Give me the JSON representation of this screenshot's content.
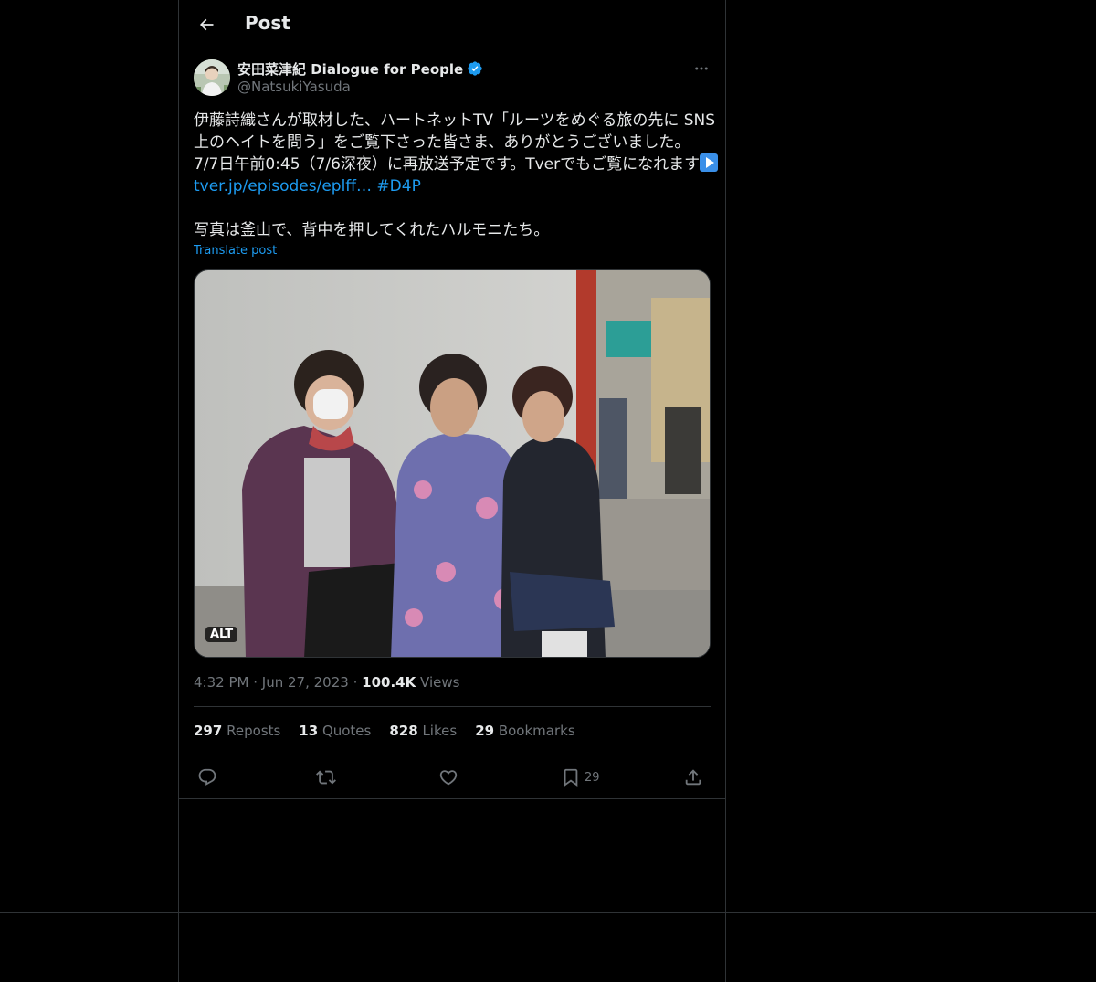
{
  "header": {
    "title": "Post",
    "back_icon": "arrow-left-icon"
  },
  "author": {
    "display_name": "安田菜津紀 Dialogue for People",
    "handle": "@NatsukiYasuda",
    "verified_icon": "verified-badge-icon",
    "verified_color": "#1d9bf0"
  },
  "post": {
    "line1": "伊藤詩織さんが取材した、ハートネットTV「ルーツをめぐる旅の先に SNS",
    "line2": "上のヘイトを問う」をご覧下さった皆さま、ありがとうございました。",
    "line3": "7/7日午前0:45（7/6深夜）に再放送予定です。Tverでもご覧になれます",
    "link_text": "tver.jp/episodes/eplff…",
    "hashtag": "#D4P",
    "line5": "写真は釜山で、背中を押してくれたハルモニたち。",
    "translate_label": "Translate post"
  },
  "media": {
    "alt_badge": "ALT"
  },
  "meta": {
    "time": "4:32 PM",
    "date": "Jun 27, 2023",
    "views_count": "100.4K",
    "views_label": "Views",
    "separator": "·"
  },
  "stats": {
    "reposts_count": "297",
    "reposts_label": "Reposts",
    "quotes_count": "13",
    "quotes_label": "Quotes",
    "likes_count": "828",
    "likes_label": "Likes",
    "bookmarks_count": "29",
    "bookmarks_label": "Bookmarks"
  },
  "actions": {
    "reply_icon": "reply-icon",
    "repost_icon": "repost-icon",
    "like_icon": "heart-icon",
    "bookmark_icon": "bookmark-icon",
    "bookmark_count": "29",
    "share_icon": "share-icon"
  },
  "colors": {
    "background": "#000000",
    "text": "#e7e9ea",
    "muted": "#71767b",
    "accent": "#1d9bf0",
    "border": "#2f3336"
  }
}
